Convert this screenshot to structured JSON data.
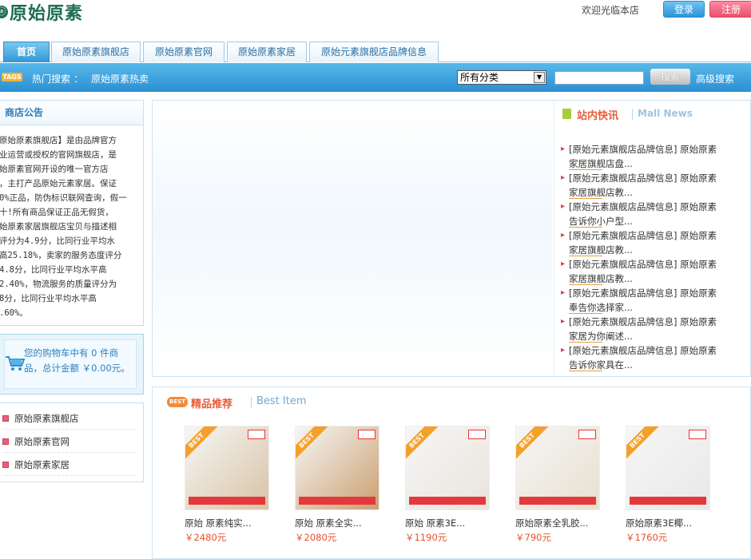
{
  "header": {
    "logo_text": "原始原素",
    "welcome": "欢迎光临本店",
    "login": "登录",
    "register": "注册"
  },
  "nav": {
    "tabs": [
      "首页",
      "原始原素旗舰店",
      "原始原素官网",
      "原始原素家居",
      "原始元素旗舰店品牌信息"
    ]
  },
  "search": {
    "tags_badge": "TAGS",
    "hot_label": "热门搜索 ：",
    "hot_link": "原始原素热卖",
    "category_selected": "所有分类",
    "search_placeholder": "",
    "search_button": "搜索",
    "advanced": "高级搜索"
  },
  "notice": {
    "title": "商店公告",
    "text": "原始原素旗舰店】是由品牌官方\n业运营或授权的官网旗舰店，是\n始原素官网开设的唯一官方店\n，主打产品原始元素家居。保证\n0%正品，防伪标识联网查询，假一\n十!所有商品保证正品无假货，\n始原素家居旗舰店宝贝与描述相\n评分为4.9分，比同行业平均水\n高25.18%，卖家的服务态度评分\n4.8分，比同行业平均水平高\n2.40%，物流服务的质量评分为\n8分，比同行业平均水平高\n.60%。"
  },
  "cart": {
    "text": "您的购物车中有 0 件商品，总计金额 ￥0.00元。"
  },
  "links": [
    "原始原素旗舰店",
    "原始原素官网",
    "原始原素家居"
  ],
  "news": {
    "title_cn": "站内快讯",
    "title_en": "Mall News",
    "items": [
      {
        "line1": "[原始元素旗舰店品牌信息] 原始原素",
        "line2": "家居旗舰店盘..."
      },
      {
        "line1": "[原始元素旗舰店品牌信息] 原始原素",
        "line2": "家居旗舰店教..."
      },
      {
        "line1": "[原始元素旗舰店品牌信息] 原始原素",
        "line2": "告诉你小户型..."
      },
      {
        "line1": "[原始元素旗舰店品牌信息] 原始原素",
        "line2": "家居旗舰店教..."
      },
      {
        "line1": "[原始元素旗舰店品牌信息] 原始原素",
        "line2": "家居旗舰店教..."
      },
      {
        "line1": "[原始元素旗舰店品牌信息] 原始原素",
        "line2": "奉告你选择家..."
      },
      {
        "line1": "[原始元素旗舰店品牌信息] 原始原素",
        "line2": "家居为你阐述..."
      },
      {
        "line1": "[原始元素旗舰店品牌信息] 原始原素",
        "line2": "告诉你家具在..."
      }
    ]
  },
  "recommend": {
    "badge": "BEST",
    "title_cn": "精品推荐",
    "title_en": "Best Item",
    "products": [
      {
        "name": "原始 原素纯实...",
        "price": "￥2480元",
        "ribbon": "BEST"
      },
      {
        "name": "原始 原素全实...",
        "price": "￥2080元",
        "ribbon": "BEST"
      },
      {
        "name": "原始 原素3E...",
        "price": "￥1190元",
        "ribbon": "BEST"
      },
      {
        "name": "原始原素全乳胶...",
        "price": "￥790元",
        "ribbon": "BEST"
      },
      {
        "name": "原始原素3E椰...",
        "price": "￥1760元",
        "ribbon": "BEST"
      }
    ]
  },
  "colors": {
    "accent_blue": "#2b8fd3",
    "price_orange": "#e8502a",
    "register_pink": "#e8506d"
  }
}
